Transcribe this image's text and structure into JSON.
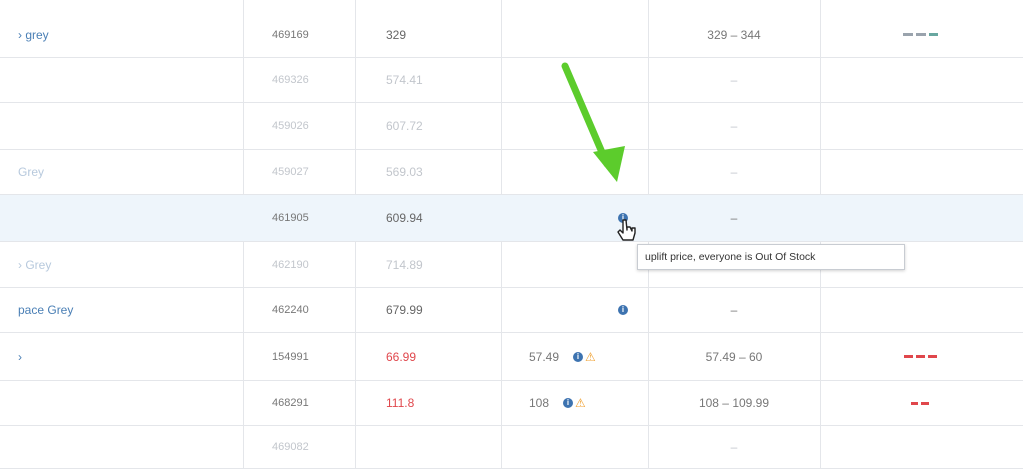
{
  "rows": [
    {
      "name": "› grey",
      "sku": "469169",
      "price": "329",
      "price_red": false,
      "market_price": "",
      "info": false,
      "warning": false,
      "range": "329 – 344",
      "trend": "grey",
      "faded": false,
      "highlight": false
    },
    {
      "name": "",
      "sku": "469326",
      "price": "574.41",
      "price_red": false,
      "market_price": "",
      "info": false,
      "warning": false,
      "range": "–",
      "trend": "",
      "faded": true,
      "highlight": false
    },
    {
      "name": "",
      "sku": "459026",
      "price": "607.72",
      "price_red": false,
      "market_price": "",
      "info": false,
      "warning": false,
      "range": "–",
      "trend": "",
      "faded": true,
      "highlight": false
    },
    {
      "name": "Grey",
      "sku": "459027",
      "price": "569.03",
      "price_red": false,
      "market_price": "",
      "info": false,
      "warning": false,
      "range": "–",
      "trend": "",
      "faded": true,
      "highlight": false
    },
    {
      "name": "",
      "sku": "461905",
      "price": "609.94",
      "price_red": false,
      "market_price": "",
      "info": true,
      "warning": false,
      "range": "–",
      "trend": "",
      "faded": false,
      "highlight": true
    },
    {
      "name": "› Grey",
      "sku": "462190",
      "price": "714.89",
      "price_red": false,
      "market_price": "",
      "info": false,
      "warning": false,
      "range": "",
      "trend": "",
      "faded": true,
      "highlight": false
    },
    {
      "name": "pace Grey",
      "sku": "462240",
      "price": "679.99",
      "price_red": false,
      "market_price": "",
      "info": true,
      "warning": false,
      "range": "–",
      "trend": "",
      "faded": false,
      "highlight": false
    },
    {
      "name": "›",
      "sku": "154991",
      "price": "66.99",
      "price_red": true,
      "market_price": "57.49",
      "info": true,
      "warning": true,
      "range": "57.49 – 60",
      "trend": "red",
      "faded": false,
      "highlight": false
    },
    {
      "name": "",
      "sku": "468291",
      "price": "111.8",
      "price_red": true,
      "market_price": "108",
      "info": true,
      "warning": true,
      "range": "108 – 109.99",
      "trend": "red-short",
      "faded": false,
      "highlight": false
    },
    {
      "name": "",
      "sku": "469082",
      "price": "",
      "price_red": false,
      "market_price": "",
      "info": false,
      "warning": false,
      "range": "–",
      "trend": "",
      "faded": true,
      "highlight": false
    }
  ],
  "tooltip": {
    "text": "uplift price, everyone is Out Of Stock"
  },
  "colors": {
    "link": "#4a7fb5",
    "red_price": "#e0474c",
    "info": "#3d73b0",
    "warning": "#f0a030",
    "arrow": "#5ccc2c"
  },
  "icons": {
    "info": "info-icon",
    "warning": "warning-icon",
    "cursor": "pointer-cursor-icon",
    "arrow": "green-annotation-arrow"
  }
}
